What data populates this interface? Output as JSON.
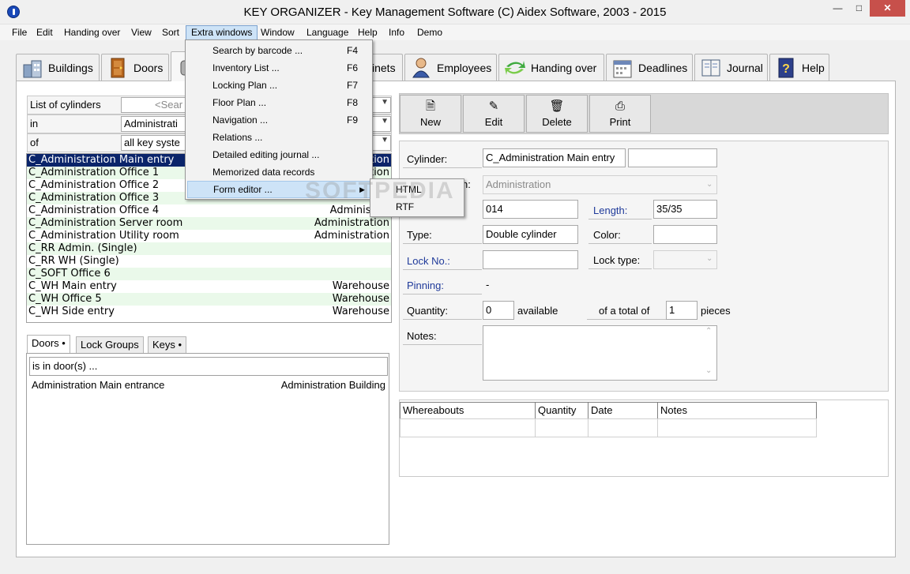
{
  "window": {
    "title": "KEY ORGANIZER  -  Key Management Software    (C) Aidex Software, 2003 - 2015",
    "min": "—",
    "max": "□",
    "close": "✕"
  },
  "menubar": [
    "File",
    "Edit",
    "Handing over",
    "View",
    "Sort",
    "Extra windows",
    "Window",
    "Language",
    "Help",
    "Info",
    "Demo"
  ],
  "tabs": [
    {
      "label": "Buildings",
      "icon": "buildings-icon"
    },
    {
      "label": "Doors",
      "icon": "door-icon"
    },
    {
      "label": "",
      "icon": "cylinder-icon"
    },
    {
      "label": "inets",
      "icon": "cabinet-icon"
    },
    {
      "label": "Employees",
      "icon": "employee-icon"
    },
    {
      "label": "Handing over",
      "icon": "handing-over-icon"
    },
    {
      "label": "Deadlines",
      "icon": "calendar-icon"
    },
    {
      "label": "Journal",
      "icon": "journal-icon"
    },
    {
      "label": "Help",
      "icon": "help-book-icon"
    }
  ],
  "filter": {
    "list_label": "List of cylinders",
    "search_placeholder": "<Sear",
    "in_label": "in",
    "in_value": "Administrati",
    "of_label": "of",
    "of_value": "all key syste"
  },
  "cylinders": [
    {
      "name": "C_Administration Main entry",
      "area": "ation"
    },
    {
      "name": "C_Administration Office 1",
      "area": "ation"
    },
    {
      "name": "C_Administration Office 2",
      "area": ""
    },
    {
      "name": "C_Administration Office 3",
      "area": ""
    },
    {
      "name": "C_Administration Office 4",
      "area": "Administrat"
    },
    {
      "name": "C_Administration Server room",
      "area": "Administration"
    },
    {
      "name": "C_Administration Utility room",
      "area": "Administration"
    },
    {
      "name": "C_RR Admin. (Single)",
      "area": ""
    },
    {
      "name": "C_RR WH (Single)",
      "area": ""
    },
    {
      "name": "C_SOFT Office 6",
      "area": ""
    },
    {
      "name": "C_WH Main entry",
      "area": "Warehouse"
    },
    {
      "name": "C_WH Office 5",
      "area": "Warehouse"
    },
    {
      "name": "C_WH Side entry",
      "area": "Warehouse"
    }
  ],
  "subtabs": [
    "Doors •",
    "Lock Groups",
    "Keys •"
  ],
  "doors_panel": {
    "header": "is in door(s) ...",
    "row_door": "Administration Main entrance",
    "row_building": "Administration Building"
  },
  "toolbar": {
    "new": "New",
    "edit": "Edit",
    "delete": "Delete",
    "print": "Print"
  },
  "form": {
    "cylinder_label": "Cylinder:",
    "cylinder_value": "C_Administration Main entry",
    "location_label": "n:",
    "location_value": "Administration",
    "number_value": "014",
    "length_label": "Length:",
    "length_value": "35/35",
    "type_label": "Type:",
    "type_value": "Double cylinder",
    "color_label": "Color:",
    "lock_no_label": "Lock No.:",
    "lock_type_label": "Lock type:",
    "pinning_label": "Pinning:",
    "pinning_value": "-",
    "quantity_label": "Quantity:",
    "quantity_value": "0",
    "available_label": "available",
    "total_label": "of a total of",
    "total_value": "1",
    "pieces_label": "pieces",
    "notes_label": "Notes:"
  },
  "grid": {
    "columns": [
      "Whereabouts",
      "Quantity",
      "Date",
      "Notes"
    ]
  },
  "extra_menu": {
    "items": [
      {
        "label": "Search by barcode ...",
        "shortcut": "F4"
      },
      {
        "label": "Inventory List ...",
        "shortcut": "F6"
      },
      {
        "label": "Locking Plan ...",
        "shortcut": "F7"
      },
      {
        "label": "Floor Plan ...",
        "shortcut": "F8"
      },
      {
        "label": "Navigation ...",
        "shortcut": "F9"
      },
      {
        "label": "Relations ...",
        "shortcut": ""
      },
      {
        "label": "Detailed editing journal ...",
        "shortcut": ""
      },
      {
        "label": "Memorized data records",
        "shortcut": ""
      },
      {
        "label": "Form editor ...",
        "shortcut": ""
      }
    ],
    "submenu": [
      "HTML",
      "RTF"
    ]
  },
  "watermark": "SOFTPEDIA",
  "colors": {
    "selection": "#0a246a",
    "alt_row": "#eaf9ea",
    "link_label": "#1f3a9a",
    "close_button": "#c7504b"
  }
}
